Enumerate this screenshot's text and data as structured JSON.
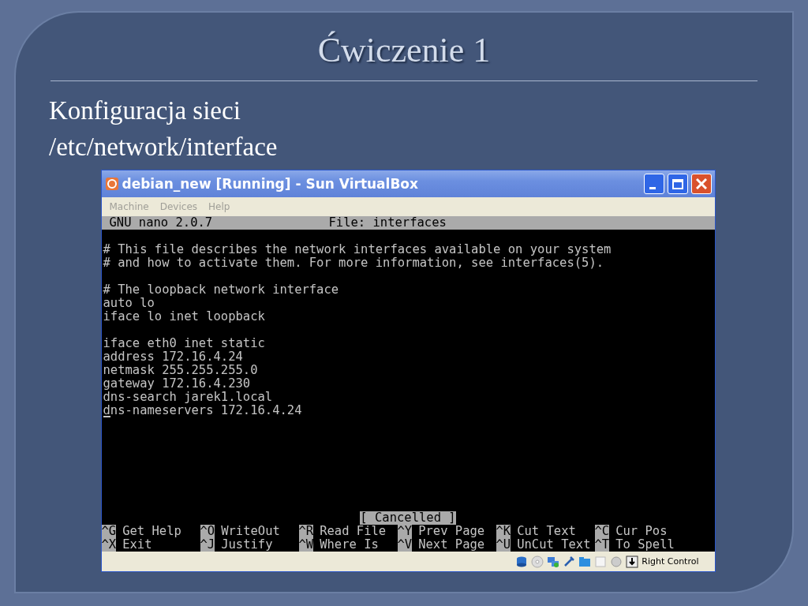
{
  "slide": {
    "title": "Ćwiczenie 1",
    "bullets": [
      "Konfiguracja sieci",
      "/etc/network/interface"
    ]
  },
  "window": {
    "title": "debian_new [Running] - Sun VirtualBox",
    "menu": [
      {
        "label": "Machine",
        "disabled": true
      },
      {
        "label": "Devices",
        "disabled": true
      },
      {
        "label": "Help",
        "disabled": true
      }
    ],
    "nano": {
      "version": "GNU nano 2.0.7",
      "file": "File: interfaces",
      "blocks": [
        [
          {
            "text": "# This file describes the network interfaces available on your system",
            "cursor": false
          },
          {
            "text": "# and how to activate them. For more information, see interfaces(5).",
            "cursor": false
          }
        ],
        [
          {
            "text": "# The loopback network interface",
            "cursor": false
          },
          {
            "text": "auto lo",
            "cursor": false
          },
          {
            "text": "iface lo inet loopback",
            "cursor": false
          }
        ],
        [
          {
            "text": "iface eth0 inet static",
            "cursor": false
          },
          {
            "text": "address 172.16.4.24",
            "cursor": false
          },
          {
            "text": "netmask 255.255.255.0",
            "cursor": false
          },
          {
            "text": "gateway 172.16.4.230",
            "cursor": false
          },
          {
            "text": "dns-search jarek1.local",
            "cursor": false
          },
          {
            "text": "dns-nameservers 172.16.4.24",
            "cursor": true
          }
        ]
      ],
      "message": "[ Cancelled ]",
      "shortcuts": [
        [
          {
            "key": "^G",
            "label": "Get Help"
          },
          {
            "key": "^O",
            "label": "WriteOut"
          },
          {
            "key": "^R",
            "label": "Read File"
          },
          {
            "key": "^Y",
            "label": "Prev Page"
          },
          {
            "key": "^K",
            "label": "Cut Text"
          },
          {
            "key": "^C",
            "label": "Cur Pos"
          }
        ],
        [
          {
            "key": "^X",
            "label": "Exit"
          },
          {
            "key": "^J",
            "label": "Justify"
          },
          {
            "key": "^W",
            "label": "Where Is"
          },
          {
            "key": "^V",
            "label": "Next Page"
          },
          {
            "key": "^U",
            "label": "UnCut Text"
          },
          {
            "key": "^T",
            "label": "To Spell"
          }
        ]
      ]
    },
    "status_bar": {
      "host_key": "Right Control"
    }
  }
}
